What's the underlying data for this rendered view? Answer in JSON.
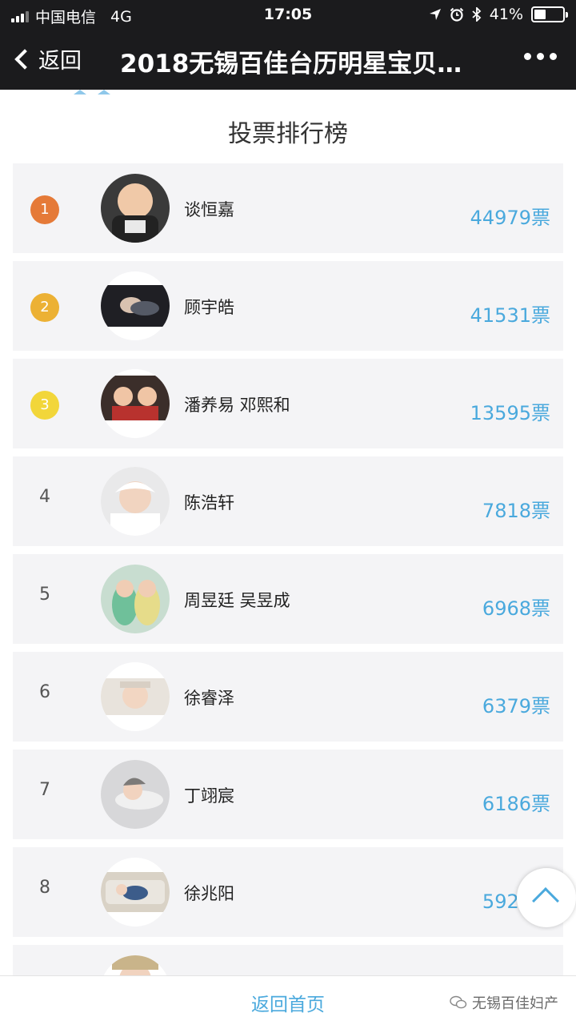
{
  "status_bar": {
    "carrier": "中国电信",
    "network": "4G",
    "time": "17:05",
    "battery": "41%",
    "battery_level": 0.41
  },
  "nav": {
    "back_label": "返回",
    "title": "2018无锡百佳台历明星宝贝…"
  },
  "section_title": "投票排行榜",
  "ranking": [
    {
      "rank": "1",
      "name": "谈恒嘉",
      "votes": "44979票",
      "badge_color": "#e57a38"
    },
    {
      "rank": "2",
      "name": "顾宇皓",
      "votes": "41531票",
      "badge_color": "#ecb134"
    },
    {
      "rank": "3",
      "name": "潘养易 邓熙和",
      "votes": "13595票",
      "badge_color": "#f2d63a"
    },
    {
      "rank": "4",
      "name": "陈浩轩",
      "votes": "7818票"
    },
    {
      "rank": "5",
      "name": "周昱廷 吴昱成",
      "votes": "6968票"
    },
    {
      "rank": "6",
      "name": "徐睿泽",
      "votes": "6379票"
    },
    {
      "rank": "7",
      "name": "丁翊宸",
      "votes": "6186票"
    },
    {
      "rank": "8",
      "name": "徐兆阳",
      "votes": "5920票"
    }
  ],
  "footer": {
    "home_label": "返回首页",
    "watermark": "无锡百佳妇产"
  },
  "colors": {
    "accent": "#4aa9dd",
    "header_bg": "#1b1b1d",
    "row_bg": "#f4f4f6"
  }
}
